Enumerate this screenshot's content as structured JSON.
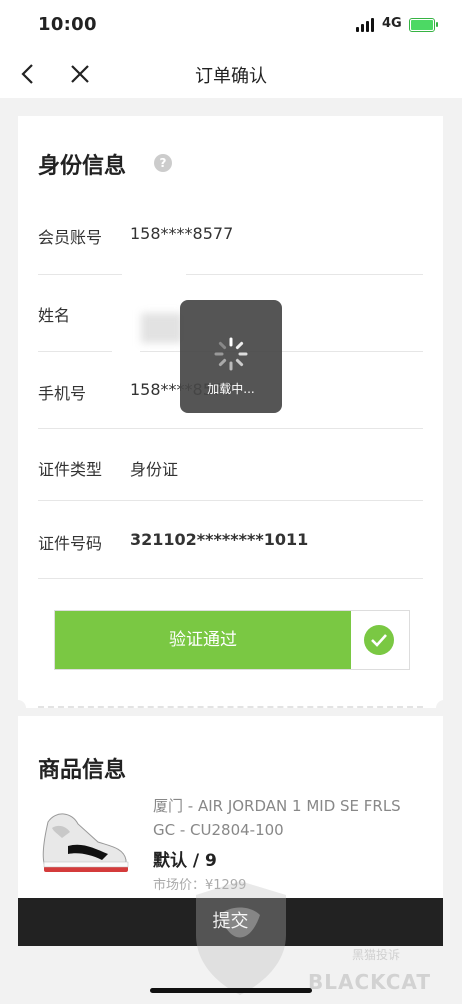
{
  "status_bar": {
    "time": "10:00",
    "network": "4G"
  },
  "nav": {
    "title": "订单确认"
  },
  "identity": {
    "section_title": "身份信息",
    "help_icon": "?",
    "rows": [
      {
        "label": "会员账号",
        "value": "158****8577"
      },
      {
        "label": "姓名",
        "value": ""
      },
      {
        "label": "手机号",
        "value": "158****8577"
      },
      {
        "label": "证件类型",
        "value": "身份证"
      },
      {
        "label": "证件号码",
        "value": "321102********1011"
      }
    ],
    "verify_label": "验证通过"
  },
  "loading": {
    "text": "加载中..."
  },
  "product": {
    "section_title": "商品信息",
    "name": "厦门 - AIR JORDAN 1 MID SE FRLS GC - CU2804-100",
    "spec": "默认 / 9",
    "market_price": "市场价：¥1299"
  },
  "submit": {
    "label": "提交"
  },
  "watermark": {
    "text": "BLACKCAT",
    "sub": "黑猫投诉"
  },
  "colors": {
    "accent_green": "#7ac843",
    "submit_bg": "#222222"
  }
}
